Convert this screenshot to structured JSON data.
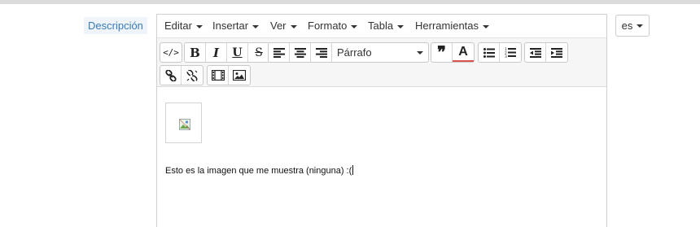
{
  "field": {
    "label": "Descripción"
  },
  "menubar": {
    "items": [
      {
        "label": "Editar"
      },
      {
        "label": "Insertar"
      },
      {
        "label": "Ver"
      },
      {
        "label": "Formato"
      },
      {
        "label": "Tabla"
      },
      {
        "label": "Herramientas"
      }
    ]
  },
  "toolbar": {
    "source_code": "</>",
    "bold": "B",
    "italic": "I",
    "underline": "U",
    "strikethrough": "S",
    "format_select": "Párrafo",
    "blockquote": "❞",
    "text_color": "A"
  },
  "content": {
    "text": "Esto es la imagen que me muestra (ninguna) :("
  },
  "language": {
    "label": "es"
  },
  "colors": {
    "label_bg": "#eef4fa",
    "label_text": "#3a7ab8",
    "toolbar_bg": "#f6f6f6",
    "border": "#cfcfcf"
  }
}
